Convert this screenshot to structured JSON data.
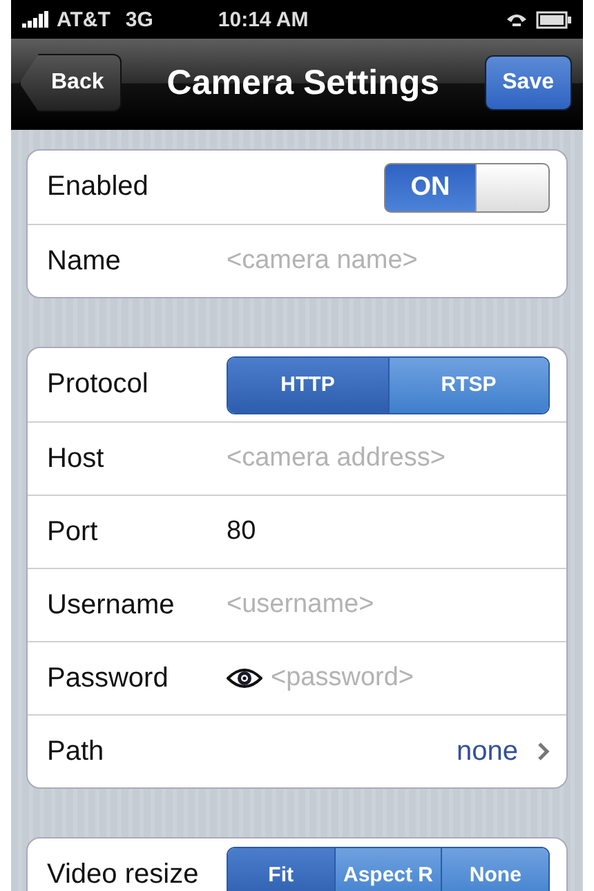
{
  "status_bar": {
    "carrier": "AT&T",
    "network": "3G",
    "time": "10:14 AM"
  },
  "nav_bar": {
    "back": "Back",
    "title": "Camera Settings",
    "action": "Save"
  },
  "sections": [
    {
      "rows": [
        {
          "kind": "toggle",
          "label": "Enabled",
          "on": true,
          "on_label": "ON"
        },
        {
          "kind": "field",
          "label": "Name",
          "placeholder": "<camera name>"
        }
      ]
    },
    {
      "rows": [
        {
          "kind": "segmented",
          "label": "Protocol",
          "options": [
            {
              "label": "HTTP",
              "selected": true
            },
            {
              "label": "RTSP",
              "selected": false
            }
          ]
        },
        {
          "kind": "field",
          "label": "Host",
          "placeholder": "<camera address>"
        },
        {
          "kind": "field",
          "label": "Port",
          "value": "80"
        },
        {
          "kind": "field",
          "label": "Username",
          "placeholder": "<username>"
        },
        {
          "kind": "password",
          "label": "Password",
          "placeholder": "<password>"
        },
        {
          "kind": "link",
          "label": "Path",
          "value": "none"
        }
      ]
    },
    {
      "rows": [
        {
          "kind": "segmented",
          "label": "Video resize",
          "options": [
            {
              "label": "Fit",
              "selected": true
            },
            {
              "label": "Aspect R",
              "selected": false
            },
            {
              "label": "None",
              "selected": false
            }
          ]
        }
      ]
    }
  ]
}
